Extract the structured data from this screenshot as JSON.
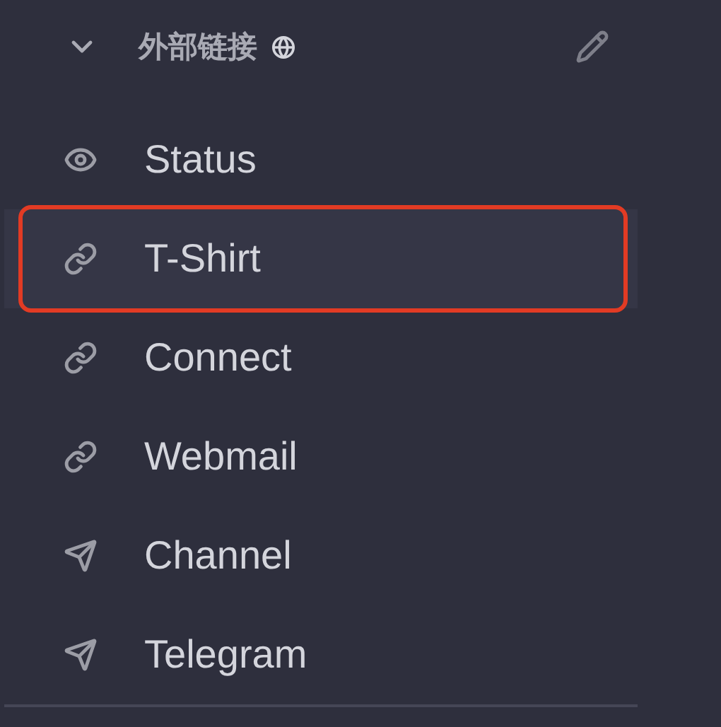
{
  "section": {
    "title": "外部链接",
    "expanded": true
  },
  "items": [
    {
      "label": "Status",
      "kind": "eye",
      "selected": false
    },
    {
      "label": "T-Shirt",
      "kind": "link",
      "selected": true
    },
    {
      "label": "Connect",
      "kind": "link",
      "selected": false
    },
    {
      "label": "Webmail",
      "kind": "link",
      "selected": false
    },
    {
      "label": "Channel",
      "kind": "send",
      "selected": false
    },
    {
      "label": "Telegram",
      "kind": "send",
      "selected": false
    }
  ]
}
